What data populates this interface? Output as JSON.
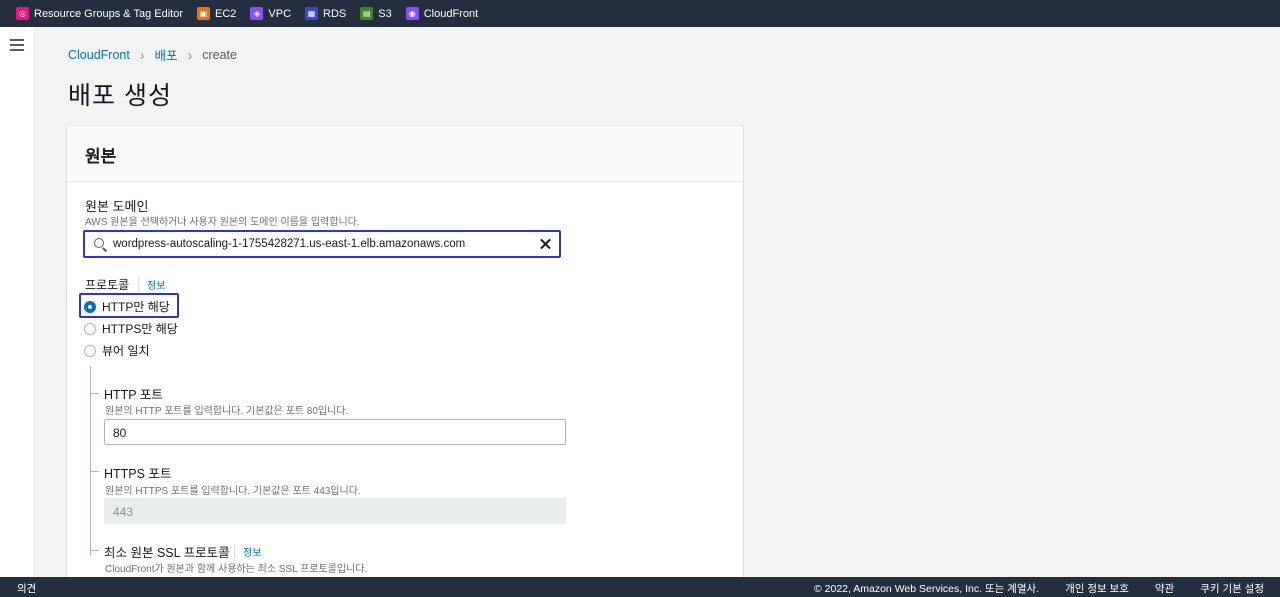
{
  "favorites": [
    {
      "label": "Resource Groups & Tag Editor",
      "icon": "resource-groups-icon",
      "color": "#e7157b"
    },
    {
      "label": "EC2",
      "icon": "ec2-icon",
      "color": "#ec7211"
    },
    {
      "label": "VPC",
      "icon": "vpc-icon",
      "color": "#8c4fff"
    },
    {
      "label": "RDS",
      "icon": "rds-icon",
      "color": "#3b48cc"
    },
    {
      "label": "S3",
      "icon": "s3-icon",
      "color": "#3f8624"
    },
    {
      "label": "CloudFront",
      "icon": "cloudfront-icon",
      "color": "#8c4fff"
    }
  ],
  "breadcrumb": {
    "items": [
      "CloudFront",
      "배포"
    ],
    "current": "create"
  },
  "page_title": "배포 생성",
  "origin_panel": {
    "title": "원본",
    "domain": {
      "label": "원본 도메인",
      "description": "AWS 원본을 선택하거나 사용자 원본의 도메인 이름을 입력합니다.",
      "value": "wordpress-autoscaling-1-1755428271.us-east-1.elb.amazonaws.com"
    },
    "protocol": {
      "label": "프로토콜",
      "info": "정보",
      "options": [
        "HTTP만 해당",
        "HTTPS만 해당",
        "뷰어 일치"
      ],
      "selected": "HTTP만 해당"
    },
    "http_port": {
      "label": "HTTP 포트",
      "description": "원본의 HTTP 포트를 입력합니다. 기본값은 포트 80입니다.",
      "value": "80"
    },
    "https_port": {
      "label": "HTTPS 포트",
      "description": "원본의 HTTPS 포트를 입력합니다. 기본값은 포트 443입니다.",
      "value": "443"
    },
    "ssl_protocol": {
      "label": "최소 원본 SSL 프로토콜",
      "info": "정보",
      "description": "CloudFront가 원본과 함께 사용하는 최소 SSL 프로토콜입니다."
    }
  },
  "footer": {
    "feedback": "의견",
    "copyright": "© 2022, Amazon Web Services, Inc. 또는 계열사.",
    "privacy": "개인 정보 보호",
    "terms": "약관",
    "cookies": "쿠키 기본 설정"
  },
  "colors": {
    "topbar": "#232f3e",
    "link": "#0073bb",
    "focus": "#3035c7"
  }
}
